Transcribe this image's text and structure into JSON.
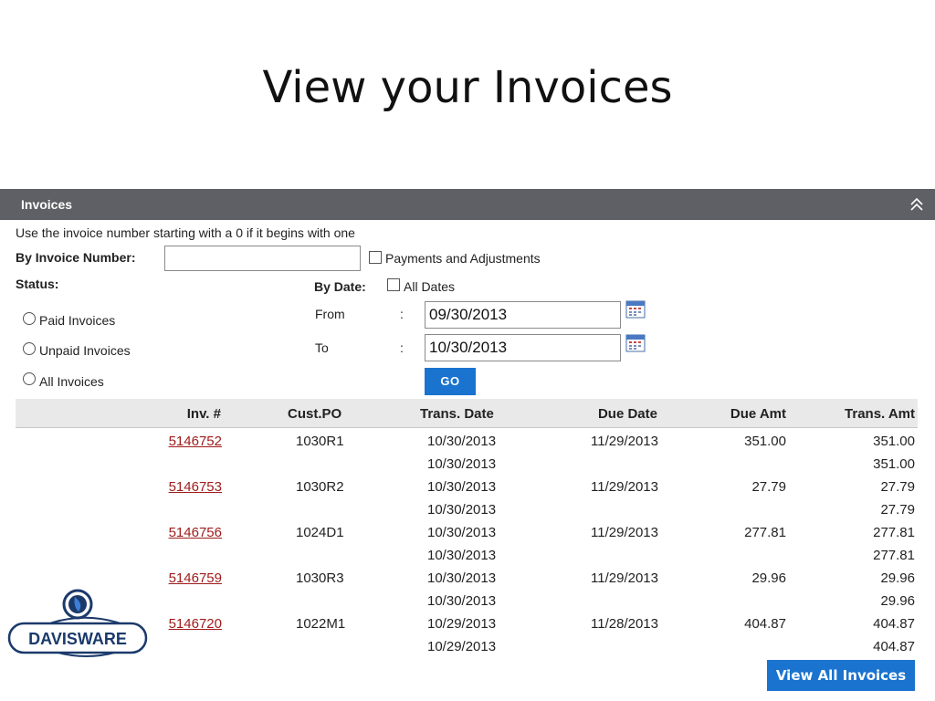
{
  "slide": {
    "title": "View your Invoices"
  },
  "panel": {
    "title": "Invoices"
  },
  "filters": {
    "hint": "Use the invoice number starting with a 0 if it begins with one",
    "invoice_number_label": "By Invoice Number:",
    "invoice_number_value": "",
    "payments_adjustments_label": "Payments and Adjustments",
    "status_label": "Status:",
    "by_date_label": "By Date:",
    "all_dates_label": "All Dates",
    "status_options": [
      "Paid Invoices",
      "Unpaid Invoices",
      "All Invoices"
    ],
    "from_label": "From",
    "to_label": "To",
    "colon": ":",
    "from_value": "09/30/2013",
    "to_value": "10/30/2013",
    "go_label": "GO"
  },
  "table": {
    "headers": [
      "Inv. #",
      "Cust.PO",
      "Trans. Date",
      "Due Date",
      "Due Amt",
      "Trans. Amt"
    ],
    "rows": [
      {
        "inv": "5146752",
        "po": "1030R1",
        "trans_date": "10/30/2013",
        "due_date": "11/29/2013",
        "due_amt": "351.00",
        "trans_amt": "351.00",
        "sub_date": "10/30/2013",
        "sub_amt": "351.00"
      },
      {
        "inv": "5146753",
        "po": "1030R2",
        "trans_date": "10/30/2013",
        "due_date": "11/29/2013",
        "due_amt": "27.79",
        "trans_amt": "27.79",
        "sub_date": "10/30/2013",
        "sub_amt": "27.79"
      },
      {
        "inv": "5146756",
        "po": "1024D1",
        "trans_date": "10/30/2013",
        "due_date": "11/29/2013",
        "due_amt": "277.81",
        "trans_amt": "277.81",
        "sub_date": "10/30/2013",
        "sub_amt": "277.81"
      },
      {
        "inv": "5146759",
        "po": "1030R3",
        "trans_date": "10/30/2013",
        "due_date": "11/29/2013",
        "due_amt": "29.96",
        "trans_amt": "29.96",
        "sub_date": "10/30/2013",
        "sub_amt": "29.96"
      },
      {
        "inv": "5146720",
        "po": "1022M1",
        "trans_date": "10/29/2013",
        "due_date": "11/28/2013",
        "due_amt": "404.87",
        "trans_amt": "404.87",
        "sub_date": "10/29/2013",
        "sub_amt": "404.87"
      }
    ]
  },
  "view_all_label": "View All Invoices",
  "logo": {
    "text": "DAVISWARE",
    "color": "#1b3a6b"
  },
  "colors": {
    "header_bg": "#5f6065",
    "button_bg": "#1a73cf",
    "link": "#a01c1c"
  }
}
